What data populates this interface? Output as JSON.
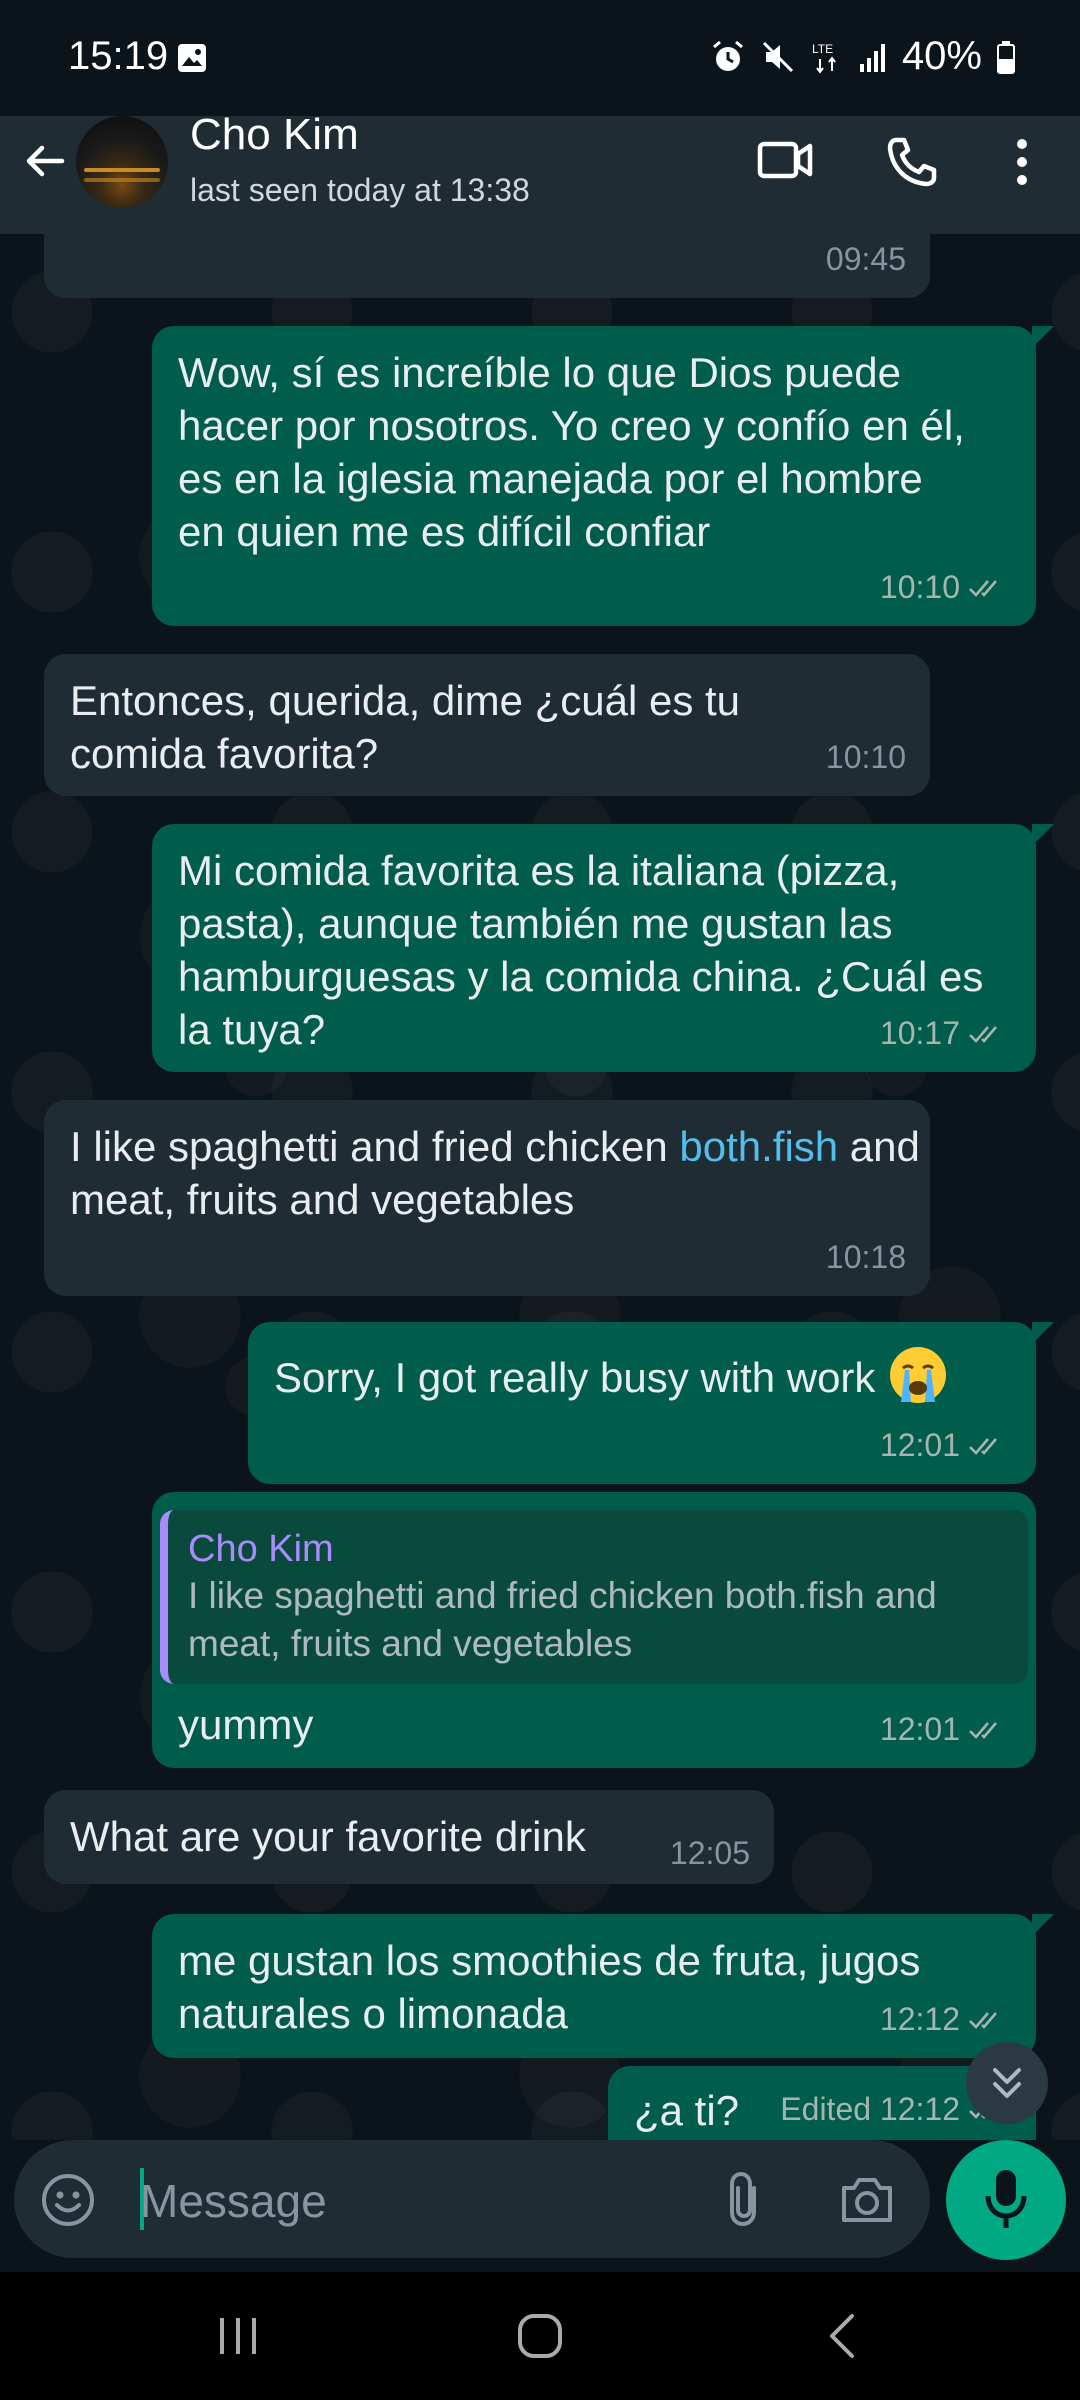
{
  "status_bar": {
    "time": "15:19",
    "battery": "40%",
    "icons": [
      "gallery-icon",
      "alarm-icon",
      "mute-icon",
      "lte-icon",
      "signal-icon",
      "battery-icon"
    ]
  },
  "header": {
    "contact_name": "Cho Kim",
    "last_seen": "last seen today at 13:38",
    "icons": [
      "back-arrow-icon",
      "video-call-icon",
      "phone-icon",
      "more-vert-icon"
    ]
  },
  "messages": [
    {
      "dir": "in",
      "text": "",
      "time": "09:45"
    },
    {
      "dir": "out",
      "text": "Wow, sí es increíble lo que Dios puede hacer por nosotros. Yo creo y confío en él, es en la iglesia manejada por el hombre en quien me es difícil confiar",
      "time": "10:10"
    },
    {
      "dir": "in",
      "text": "Entonces, querida, dime ¿cuál es tu comida favorita?",
      "time": "10:10"
    },
    {
      "dir": "out",
      "text": "Mi comida favorita es la italiana (pizza, pasta), aunque también me gustan las hamburguesas y la comida china. ¿Cuál es la tuya?",
      "time": "10:17"
    },
    {
      "dir": "in",
      "text_before": "I like spaghetti and fried chicken ",
      "link": "both.fish",
      "text_after": " and meat, fruits and vegetables",
      "time": "10:18"
    },
    {
      "dir": "out",
      "text": "Sorry, I got really busy with work",
      "emoji": "crying-face-emoji",
      "time": "12:01"
    },
    {
      "dir": "out",
      "quote_name": "Cho Kim",
      "quote_text": "I like spaghetti and fried chicken both.fish and meat, fruits and vegetables",
      "text": "yummy",
      "time": "12:01"
    },
    {
      "dir": "in",
      "text": "What are your favorite drink",
      "time": "12:05"
    },
    {
      "dir": "out",
      "text": "me gustan los smoothies de fruta, jugos naturales o limonada",
      "time": "12:12"
    },
    {
      "dir": "out",
      "text": "¿a ti?",
      "time": "Edited 12:12"
    }
  ],
  "input": {
    "placeholder": "Message",
    "icons": [
      "emoji-icon",
      "attach-icon",
      "camera-icon",
      "mic-icon"
    ]
  },
  "colors": {
    "background": "#0b141a",
    "incoming_bubble": "#202c33",
    "outgoing_bubble": "#005c4b",
    "accent": "#00a884",
    "link": "#53bdeb",
    "quote_accent": "#a88cfb"
  }
}
